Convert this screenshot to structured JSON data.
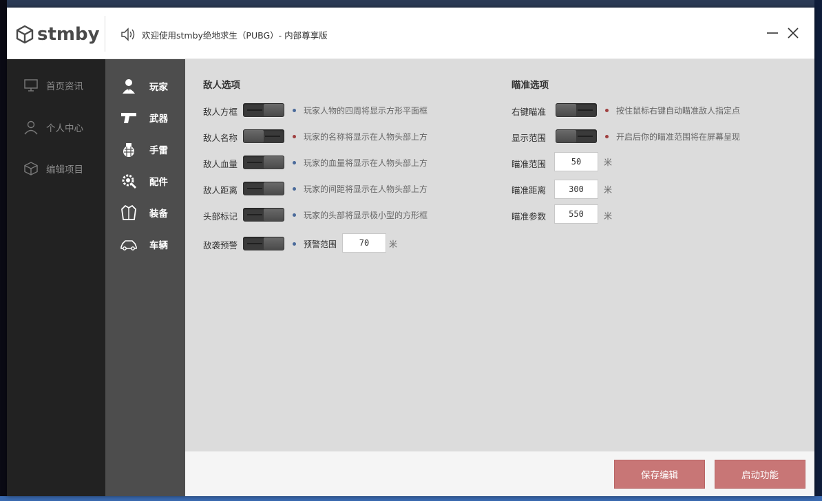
{
  "app": {
    "logo_text": "stmby",
    "welcome": "欢迎使用stmby绝地求生（PUBG）- 内部尊享版"
  },
  "nav": {
    "items": [
      {
        "label": "首页资讯",
        "icon": "monitor-icon"
      },
      {
        "label": "个人中心",
        "icon": "user-icon"
      },
      {
        "label": "编辑项目",
        "icon": "cube-icon"
      }
    ]
  },
  "categories": {
    "items": [
      {
        "label": "玩家",
        "icon": "player-icon"
      },
      {
        "label": "武器",
        "icon": "pistol-icon"
      },
      {
        "label": "手雷",
        "icon": "grenade-icon"
      },
      {
        "label": "配件",
        "icon": "gear-wrench-icon"
      },
      {
        "label": "装备",
        "icon": "vest-icon"
      },
      {
        "label": "车辆",
        "icon": "car-icon"
      }
    ]
  },
  "enemy": {
    "title": "敌人选项",
    "rows": [
      {
        "label": "敌人方框",
        "desc": "玩家人物的四周将显示方形平面框",
        "dot_color": "#4a6a9a",
        "on": true
      },
      {
        "label": "敌人名称",
        "desc": "玩家的名称将显示在人物头部上方",
        "dot_color": "#a04040",
        "on": false
      },
      {
        "label": "敌人血量",
        "desc": "玩家的血量将显示在人物头部上方",
        "dot_color": "#4a6a9a",
        "on": true
      },
      {
        "label": "敌人距离",
        "desc": "玩家的间距将显示在人物头部上方",
        "dot_color": "#4a6a9a",
        "on": true
      },
      {
        "label": "头部标记",
        "desc": "玩家的头部将显示极小型的方形框",
        "dot_color": "#4a6a9a",
        "on": true
      }
    ],
    "warning": {
      "label": "敌袭预警",
      "range_label": "预警范围",
      "value": "70",
      "unit": "米",
      "dot_color": "#4a6a9a",
      "on": true
    }
  },
  "aim": {
    "title": "瞄准选项",
    "toggles": [
      {
        "label": "右键瞄准",
        "desc": "按住鼠标右键自动瞄准敌人指定点",
        "dot_color": "#a04040",
        "on": false
      },
      {
        "label": "显示范围",
        "desc": "开启后你的瞄准范围将在屏幕呈现",
        "dot_color": "#a04040",
        "on": false
      }
    ],
    "inputs": [
      {
        "label": "瞄准范围",
        "value": "50",
        "unit": "米"
      },
      {
        "label": "瞄准距离",
        "value": "300",
        "unit": "米"
      },
      {
        "label": "瞄准参数",
        "value": "550",
        "unit": "米"
      }
    ]
  },
  "footer": {
    "save_label": "保存编辑",
    "start_label": "启动功能"
  },
  "colors": {
    "accent": "#c87676",
    "nav_bg": "#222222",
    "category_bg": "#4d4d4d",
    "content_bg": "#dcdcdc"
  }
}
